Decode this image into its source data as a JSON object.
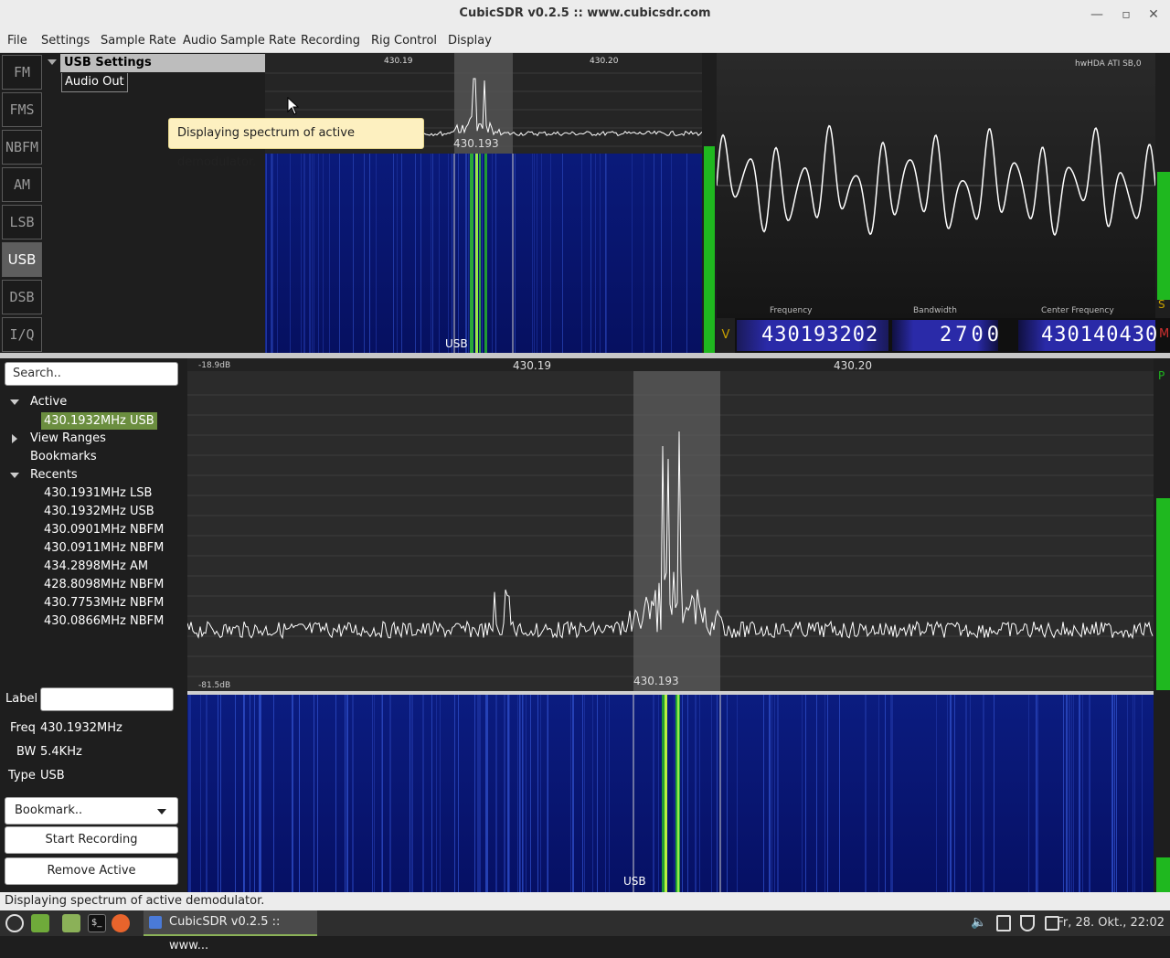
{
  "window": {
    "title": "CubicSDR v0.2.5 :: www.cubicsdr.com"
  },
  "menu": [
    "File",
    "Settings",
    "Sample Rate",
    "Audio Sample Rate",
    "Recording",
    "Rig Control",
    "Display"
  ],
  "modes": {
    "items": [
      "FM",
      "FMS",
      "NBFM",
      "AM",
      "LSB",
      "USB",
      "DSB",
      "I/Q"
    ],
    "active": "USB"
  },
  "settings_panel": {
    "header": "USB Settings",
    "audio_out": "Audio Out"
  },
  "top_spectrum": {
    "tick1": "430.19",
    "tick2": "430.20",
    "center_label": "430.193",
    "mode_label": "USB"
  },
  "tooltip": "Displaying spectrum of active demodulator.",
  "scope": {
    "device_label": "hwHDA ATI SB,0",
    "frequency_label": "Frequency",
    "bandwidth_label": "Bandwidth",
    "center_label": "Center Frequency"
  },
  "freq_displays": {
    "v_label": "V",
    "frequency": "430193202",
    "bandwidth": "2700",
    "center_frequency": "430140430",
    "s_label": "S",
    "m_label": "M",
    "p_label": "P"
  },
  "sidebar": {
    "search_placeholder": "Search..",
    "active_label": "Active",
    "active_item": "430.1932MHz USB",
    "view_ranges": "View Ranges",
    "bookmarks": "Bookmarks",
    "recents_label": "Recents",
    "recents": [
      "430.1931MHz LSB",
      "430.1932MHz USB",
      "430.0901MHz NBFM",
      "430.0911MHz NBFM",
      "434.2898MHz AM",
      "428.8098MHz NBFM",
      "430.7753MHz NBFM",
      "430.0866MHz NBFM"
    ],
    "label_caption": "Label",
    "freq_caption": "Freq",
    "freq_value": "430.1932MHz",
    "bw_caption": "BW",
    "bw_value": "5.4KHz",
    "type_caption": "Type",
    "type_value": "USB",
    "bookmark_btn": "Bookmark..",
    "start_recording": "Start Recording",
    "remove_active": "Remove Active"
  },
  "main_spectrum": {
    "top_db": "-18.9dB",
    "bottom_db": "-81.5dB",
    "tick1": "430.19",
    "tick2": "430.20",
    "center_label": "430.193",
    "mode_label": "USB"
  },
  "statusbar": "Displaying spectrum of active demodulator.",
  "taskbar": {
    "task_title": "CubicSDR v0.2.5 :: www...",
    "clock": "Fr, 28. Okt., 22:02"
  },
  "colors": {
    "accent_green": "#1fb81f",
    "selection": "#6b8e3f",
    "digit_bg": "#2a2aa8",
    "tooltip_bg": "#fdf0c0"
  }
}
